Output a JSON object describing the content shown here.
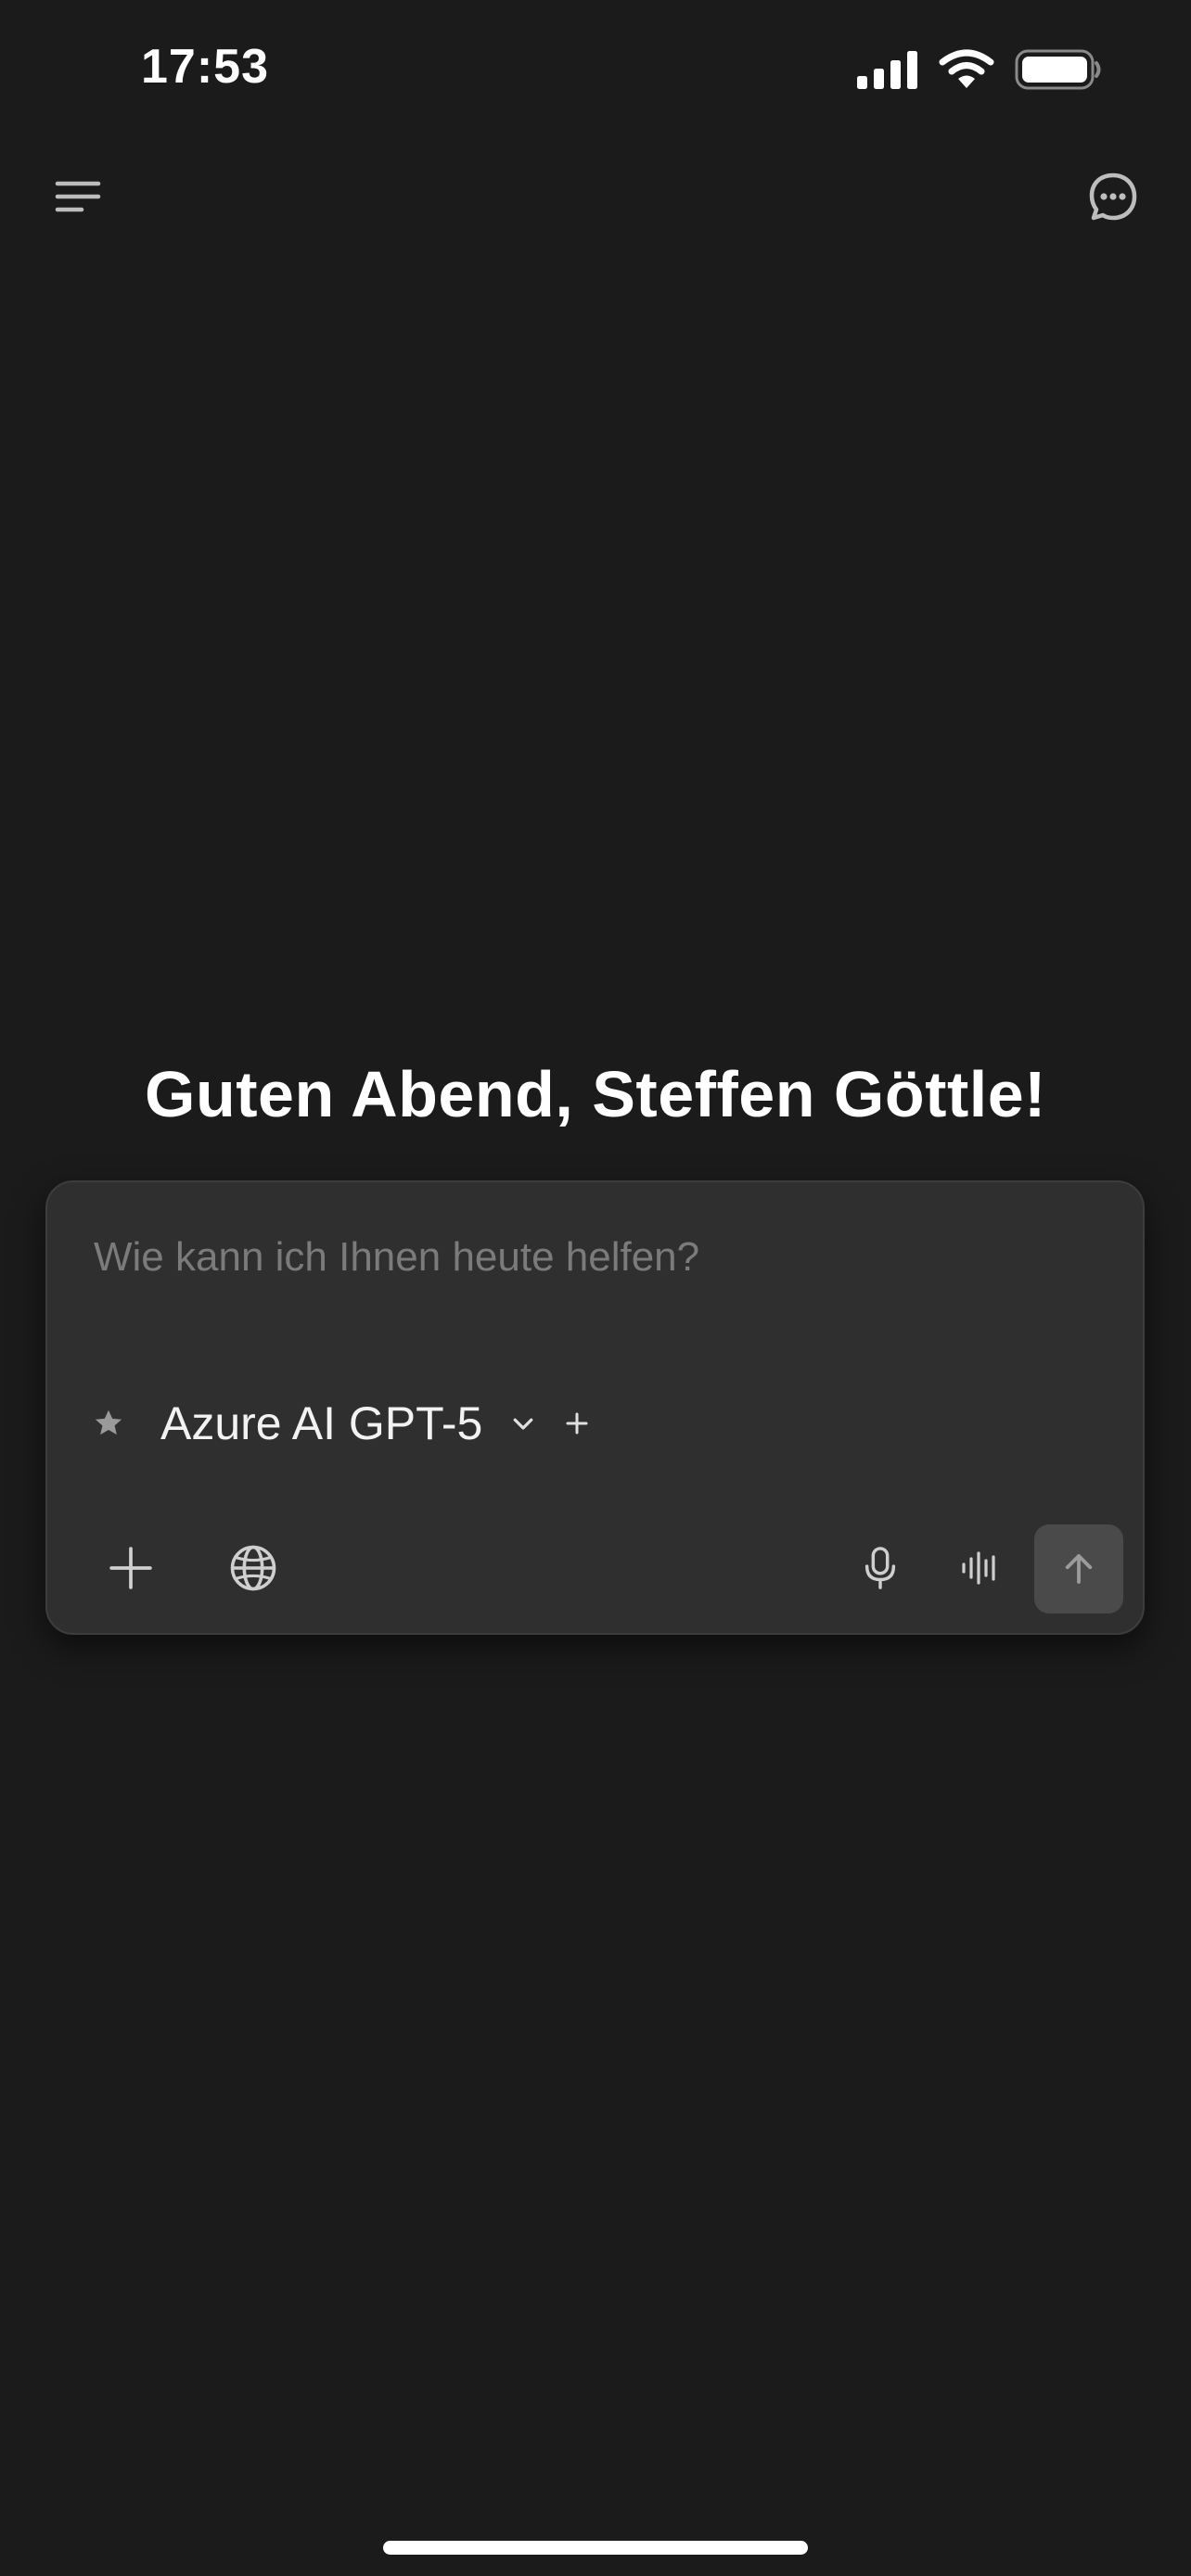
{
  "status_bar": {
    "time": "17:53",
    "icons": [
      "signal-icon",
      "wifi-icon",
      "battery-icon"
    ]
  },
  "header": {
    "menu_icon": "menu-icon",
    "new_chat_icon": "new-chat-icon"
  },
  "greeting": "Guten Abend, Steffen Göttle!",
  "composer": {
    "placeholder": "Wie kann ich Ihnen heute helfen?",
    "value": "",
    "model": {
      "name": "Azure AI GPT-5",
      "favorite_icon": "star-icon",
      "dropdown_icon": "chevron-down-icon",
      "add_label": "+"
    },
    "toolbar": [
      "plus-icon",
      "globe-icon",
      "microphone-icon",
      "voice-wave-icon",
      "send-arrow-icon"
    ]
  },
  "colors": {
    "background": "#1b1b1b",
    "composer_background": "#2f2f2f",
    "send_button": "#4a4a4a",
    "placeholder": "#7b7b7b",
    "text": "#ffffff"
  }
}
